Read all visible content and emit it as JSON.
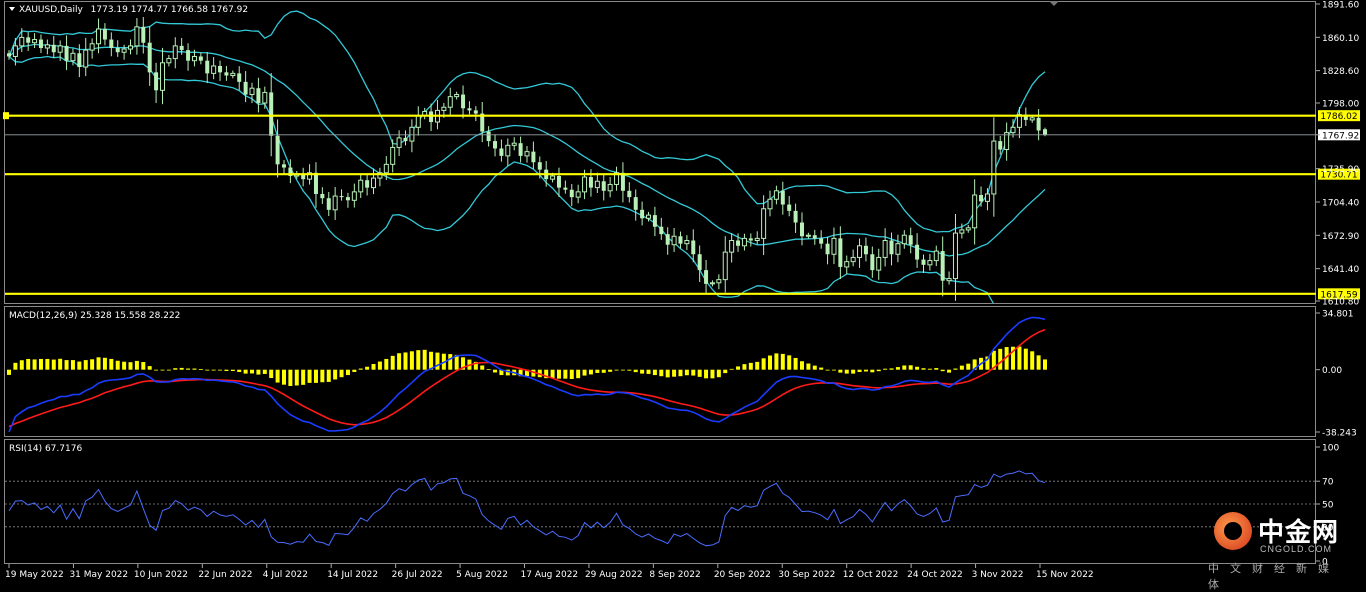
{
  "header": {
    "symbol_label": "XAUUSD,Daily",
    "ohlc": "1773.19 1774.77 1766.58 1767.92"
  },
  "colors": {
    "background": "#000000",
    "candle": "#b8f0b8",
    "bollinger": "#33c8d6",
    "level_line": "#ffff00",
    "macd_hist": "#ffff00",
    "macd_line": "#1a3cff",
    "signal_line": "#ff1a1a",
    "rsi_line": "#4a6cff"
  },
  "price_axis_ticks": [
    "1891.60",
    "1860.10",
    "1828.60",
    "1798.00",
    "1767.92",
    "1735.90",
    "1704.40",
    "1672.90",
    "1641.40",
    "1610.80"
  ],
  "level_labels": [
    "1786.02",
    "1730.71",
    "1617.59"
  ],
  "macd": {
    "label": "MACD(12,26,9) 25.328 15.558 28.222",
    "axis_ticks": [
      "34.801",
      "0.00",
      "-38.243"
    ]
  },
  "rsi": {
    "label": "RSI(14) 67.7176",
    "axis_ticks": [
      "100",
      "70",
      "50",
      "30",
      "0"
    ]
  },
  "date_labels": [
    "19 May 2022",
    "31 May 2022",
    "10 Jun 2022",
    "22 Jun 2022",
    "4 Jul 2022",
    "14 Jul 2022",
    "26 Jul 2022",
    "5 Aug 2022",
    "17 Aug 2022",
    "29 Aug 2022",
    "8 Sep 2022",
    "20 Sep 2022",
    "30 Sep 2022",
    "12 Oct 2022",
    "24 Oct 2022",
    "3 Nov 2022",
    "15 Nov 2022"
  ],
  "logo": {
    "name": "中金网",
    "domain": "CNGOLD.COM",
    "tagline": "中文财经新媒体"
  },
  "chart_data": {
    "type": "candlestick",
    "symbol": "XAUUSD",
    "timeframe": "Daily",
    "last_ohlc": {
      "open": 1773.19,
      "high": 1774.77,
      "low": 1766.58,
      "close": 1767.92
    },
    "ylim": [
      1610.8,
      1891.6
    ],
    "horizontal_levels": [
      1786.02,
      1730.71,
      1617.59
    ],
    "current_price": 1767.92,
    "close": [
      1842,
      1852,
      1860,
      1855,
      1858,
      1850,
      1853,
      1846,
      1852,
      1838,
      1845,
      1832,
      1848,
      1854,
      1868,
      1858,
      1850,
      1846,
      1849,
      1852,
      1870,
      1855,
      1827,
      1810,
      1836,
      1840,
      1852,
      1848,
      1838,
      1842,
      1838,
      1826,
      1833,
      1827,
      1824,
      1826,
      1818,
      1806,
      1812,
      1798,
      1808,
      1767,
      1740,
      1737,
      1729,
      1731,
      1726,
      1732,
      1712,
      1708,
      1697,
      1710,
      1709,
      1706,
      1714,
      1725,
      1718,
      1727,
      1732,
      1740,
      1756,
      1765,
      1762,
      1775,
      1786,
      1790,
      1780,
      1791,
      1794,
      1804,
      1806,
      1793,
      1791,
      1788,
      1771,
      1762,
      1755,
      1748,
      1758,
      1760,
      1748,
      1752,
      1742,
      1735,
      1726,
      1729,
      1718,
      1716,
      1709,
      1714,
      1728,
      1718,
      1724,
      1715,
      1721,
      1732,
      1715,
      1709,
      1697,
      1689,
      1692,
      1681,
      1674,
      1664,
      1672,
      1665,
      1668,
      1655,
      1640,
      1627,
      1628,
      1631,
      1657,
      1668,
      1663,
      1670,
      1668,
      1670,
      1698,
      1707,
      1715,
      1702,
      1696,
      1685,
      1672,
      1673,
      1670,
      1665,
      1655,
      1670,
      1643,
      1648,
      1652,
      1663,
      1655,
      1640,
      1652,
      1668,
      1655,
      1665,
      1673,
      1664,
      1650,
      1645,
      1649,
      1658,
      1630,
      1632,
      1675,
      1678,
      1680,
      1711,
      1705,
      1712,
      1762,
      1754,
      1770,
      1775,
      1787,
      1782,
      1784,
      1772,
      1768
    ],
    "macd_line": [
      -38.2,
      -28.8,
      -25.8,
      -23.4,
      -22.3,
      -20.6,
      -19.2,
      -18.3,
      -16.5,
      -16.4,
      -15.3,
      -15.2,
      -12.9,
      -11.1,
      -8.3,
      -6.9,
      -6.3,
      -6.1,
      -5.6,
      -4.9,
      -2.9,
      -2.6,
      -4.6,
      -7.4,
      -7.6,
      -7.4,
      -6.1,
      -5.5,
      -5.7,
      -5.5,
      -5.7,
      -6.5,
      -6.3,
      -6.8,
      -7.3,
      -7.5,
      -8.4,
      -10.0,
      -10.6,
      -12.1,
      -12.4,
      -16.2,
      -20.9,
      -24.4,
      -27.6,
      -29.7,
      -31.6,
      -32.4,
      -34.4,
      -35.9,
      -37.6,
      -37.5,
      -37.2,
      -36.7,
      -35.2,
      -32.9,
      -31.3,
      -28.8,
      -26.0,
      -22.8,
      -18.7,
      -14.6,
      -11.5,
      -7.9,
      -4.2,
      -1.0,
      0.6,
      2.7,
      4.5,
      6.7,
      8.5,
      8.9,
      9.0,
      8.7,
      6.9,
      4.7,
      2.3,
      -0.1,
      -1.1,
      -1.8,
      -3.4,
      -4.3,
      -5.7,
      -7.3,
      -9.2,
      -10.4,
      -12.2,
      -13.6,
      -15.2,
      -16.0,
      -15.3,
      -15.4,
      -15.0,
      -15.4,
      -15.1,
      -13.8,
      -14.1,
      -14.7,
      -16.0,
      -17.5,
      -18.4,
      -19.9,
      -21.6,
      -23.5,
      -24.1,
      -24.8,
      -25.0,
      -26.1,
      -28.0,
      -30.2,
      -31.5,
      -32.0,
      -30.0,
      -27.3,
      -25.3,
      -23.0,
      -21.2,
      -19.4,
      -15.4,
      -11.5,
      -7.7,
      -5.6,
      -4.3,
      -4.1,
      -4.8,
      -5.3,
      -5.9,
      -6.8,
      -8.3,
      -8.2,
      -10.4,
      -11.6,
      -12.2,
      -11.6,
      -11.6,
      -12.5,
      -12.1,
      -10.4,
      -10.0,
      -8.8,
      -7.2,
      -6.5,
      -7.0,
      -7.7,
      -7.8,
      -7.2,
      -9.3,
      -10.7,
      -8.0,
      -5.6,
      -3.5,
      0.7,
      3.6,
      6.4,
      12.8,
      17.2,
      21.7,
      25.4,
      29.0,
      30.9,
      32.1,
      31.8,
      30.9
    ],
    "signal_line": [
      -35.0,
      -33.0,
      -31.6,
      -30.0,
      -28.6,
      -27.2,
      -25.8,
      -24.5,
      -23.2,
      -22.3,
      -21.2,
      -20.2,
      -18.8,
      -17.5,
      -15.9,
      -14.2,
      -12.9,
      -11.6,
      -10.5,
      -9.5,
      -8.3,
      -7.3,
      -6.8,
      -7.0,
      -7.2,
      -7.3,
      -7.0,
      -6.6,
      -6.4,
      -6.2,
      -6.0,
      -6.1,
      -6.2,
      -6.3,
      -6.5,
      -6.7,
      -7.0,
      -7.6,
      -8.3,
      -9.1,
      -9.8,
      -11.1,
      -13.0,
      -15.2,
      -17.6,
      -20.0,
      -22.3,
      -24.3,
      -26.3,
      -28.2,
      -30.1,
      -31.5,
      -32.6,
      -33.4,
      -33.8,
      -33.6,
      -33.1,
      -32.3,
      -31.0,
      -29.4,
      -27.2,
      -24.7,
      -22.1,
      -19.2,
      -16.2,
      -13.2,
      -10.4,
      -7.8,
      -5.3,
      -2.9,
      -0.6,
      1.3,
      2.8,
      3.9,
      4.3,
      4.4,
      4.0,
      3.2,
      2.4,
      1.6,
      0.6,
      -0.4,
      -1.5,
      -2.7,
      -4.0,
      -5.3,
      -6.7,
      -8.1,
      -9.5,
      -10.8,
      -11.7,
      -12.5,
      -13.0,
      -13.5,
      -13.8,
      -13.8,
      -13.9,
      -14.1,
      -14.5,
      -15.1,
      -15.8,
      -16.6,
      -17.6,
      -18.8,
      -19.8,
      -20.8,
      -21.6,
      -22.5,
      -23.6,
      -24.9,
      -26.2,
      -27.4,
      -27.9,
      -27.8,
      -27.3,
      -26.4,
      -25.4,
      -24.2,
      -22.4,
      -20.2,
      -17.7,
      -15.3,
      -13.1,
      -11.3,
      -10.0,
      -9.1,
      -8.4,
      -8.1,
      -8.1,
      -8.1,
      -8.6,
      -9.2,
      -9.8,
      -10.2,
      -10.5,
      -10.9,
      -11.2,
      -11.0,
      -10.8,
      -10.4,
      -9.8,
      -9.2,
      -8.8,
      -8.6,
      -8.4,
      -8.2,
      -8.4,
      -8.9,
      -8.7,
      -8.1,
      -7.2,
      -5.6,
      -3.7,
      -1.7,
      1.2,
      4.4,
      7.8,
      11.3,
      14.8,
      18.0,
      20.8,
      23.0,
      24.6
    ],
    "macd_histogram": [
      -3.2,
      4.2,
      5.8,
      6.6,
      6.3,
      6.6,
      6.6,
      6.2,
      6.7,
      5.9,
      5.9,
      5.0,
      5.9,
      6.4,
      7.6,
      7.3,
      6.6,
      5.5,
      4.9,
      4.6,
      5.4,
      4.7,
      2.2,
      -0.4,
      -0.4,
      -0.1,
      0.9,
      1.1,
      0.7,
      0.7,
      0.3,
      -0.4,
      -0.1,
      -0.5,
      -0.8,
      -0.8,
      -1.4,
      -2.4,
      -2.3,
      -3.0,
      -2.6,
      -5.1,
      -7.9,
      -9.2,
      -10.0,
      -9.7,
      -9.3,
      -8.1,
      -8.1,
      -7.7,
      -7.5,
      -6.0,
      -4.6,
      -3.3,
      -1.4,
      0.7,
      1.8,
      3.5,
      5.0,
      6.6,
      8.5,
      10.1,
      10.6,
      11.3,
      12.0,
      12.2,
      11.0,
      10.5,
      9.8,
      9.6,
      9.1,
      7.6,
      6.2,
      4.8,
      2.6,
      0.3,
      -1.7,
      -3.3,
      -3.5,
      -3.4,
      -4.0,
      -3.9,
      -4.2,
      -4.6,
      -5.2,
      -5.1,
      -5.5,
      -5.5,
      -5.7,
      -5.2,
      -3.6,
      -2.9,
      -2.0,
      -1.9,
      -1.3,
      0.0,
      -0.2,
      -0.6,
      -1.5,
      -2.4,
      -2.6,
      -3.3,
      -4.0,
      -4.7,
      -4.3,
      -4.0,
      -3.4,
      -3.6,
      -4.4,
      -5.3,
      -5.3,
      -4.6,
      -2.1,
      0.5,
      2.0,
      3.4,
      4.2,
      4.8,
      7.0,
      8.7,
      10.0,
      9.7,
      8.8,
      7.2,
      5.2,
      3.8,
      2.5,
      1.3,
      -0.2,
      -0.1,
      -1.8,
      -2.4,
      -2.4,
      -1.4,
      -1.1,
      -1.6,
      -0.9,
      0.6,
      0.8,
      1.6,
      2.6,
      2.7,
      1.8,
      0.9,
      0.6,
      1.0,
      -0.9,
      -1.8,
      0.7,
      2.5,
      3.7,
      6.3,
      7.3,
      8.1,
      11.6,
      12.8,
      13.9,
      14.1,
      14.2,
      12.9,
      11.3,
      8.8,
      6.3
    ],
    "rsi": [
      44.0,
      52.5,
      53.0,
      49.2,
      51.0,
      45.2,
      47.9,
      42.3,
      49.0,
      36.7,
      45.9,
      37.1,
      52.8,
      56.0,
      62.6,
      52.5,
      46.0,
      43.5,
      46.3,
      49.1,
      61.5,
      45.9,
      31.3,
      26.9,
      44.3,
      46.3,
      53.0,
      50.2,
      44.6,
      47.2,
      44.9,
      39.1,
      43.7,
      40.4,
      39.1,
      40.5,
      36.5,
      31.6,
      35.6,
      29.6,
      36.5,
      21.2,
      16.4,
      16.1,
      14.7,
      17.0,
      16.5,
      23.5,
      17.1,
      16.2,
      13.8,
      24.1,
      23.8,
      23.1,
      29.6,
      37.8,
      34.8,
      41.7,
      45.3,
      50.5,
      59.2,
      63.4,
      61.4,
      67.0,
      71.0,
      72.4,
      62.2,
      67.7,
      68.8,
      72.0,
      72.5,
      59.4,
      57.3,
      54.3,
      40.7,
      35.2,
      31.3,
      27.8,
      37.4,
      39.2,
      31.6,
      35.7,
      29.9,
      26.5,
      22.9,
      26.1,
      21.6,
      20.8,
      18.3,
      22.4,
      33.7,
      29.0,
      34.1,
      29.2,
      33.8,
      41.8,
      31.6,
      28.6,
      23.7,
      21.0,
      23.7,
      19.9,
      17.9,
      15.3,
      23.7,
      21.5,
      24.0,
      19.8,
      15.9,
      13.3,
      14.1,
      16.7,
      39.8,
      47.0,
      44.3,
      48.5,
      47.2,
      48.5,
      62.0,
      65.4,
      68.2,
      59.3,
      55.8,
      49.6,
      43.3,
      43.8,
      42.4,
      40.2,
      36.1,
      45.2,
      32.9,
      36.2,
      38.9,
      45.3,
      40.9,
      34.3,
      43.3,
      51.3,
      44.1,
      50.0,
      53.9,
      48.4,
      41.2,
      39.0,
      41.7,
      46.5,
      34.2,
      35.7,
      56.3,
      57.4,
      58.2,
      67.1,
      64.6,
      66.4,
      76.2,
      73.5,
      76.2,
      77.1,
      79.0,
      76.4,
      76.9,
      70.5,
      68.7
    ]
  }
}
